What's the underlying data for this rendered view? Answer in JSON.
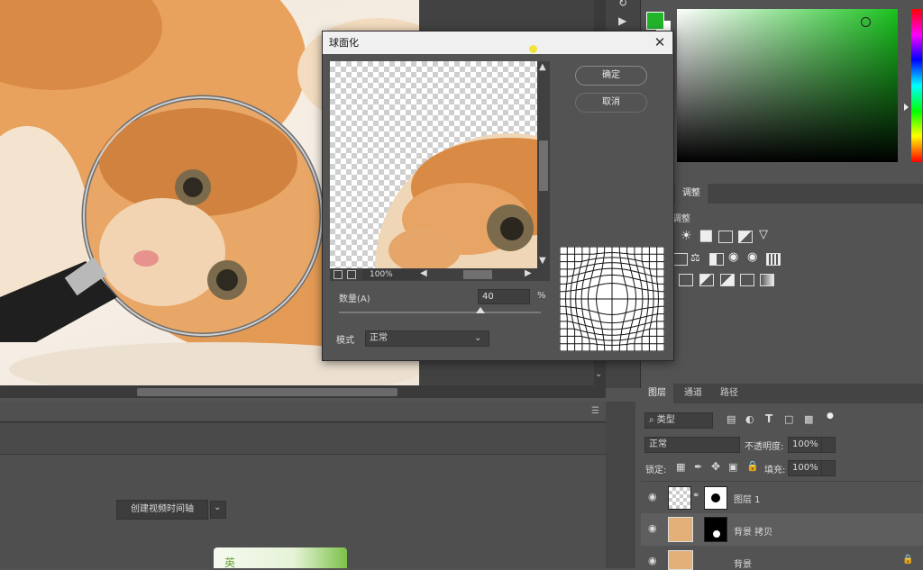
{
  "dialog": {
    "title": "球面化",
    "ok_label": "确定",
    "cancel_label": "取消",
    "zoom_value": "100%",
    "amount_label": "数量(A)",
    "amount_value": "40",
    "amount_unit": "%",
    "amount_level": 0.7,
    "mode_label": "模式",
    "mode_value": "正常"
  },
  "timeline": {
    "create_button_label": "创建视频时间轴"
  },
  "adjustments": {
    "tab_label": "调整",
    "heading": "调整"
  },
  "layers": {
    "tabs": [
      "图层",
      "通道",
      "路径"
    ],
    "filter_value": "类型",
    "blend_mode": "正常",
    "opacity_label": "不透明度:",
    "opacity_value": "100%",
    "lock_label": "锁定:",
    "fill_label": "填充:",
    "fill_value": "100%",
    "items": [
      {
        "name": "图层 1"
      },
      {
        "name": "背景 拷贝"
      },
      {
        "name": "背景"
      }
    ]
  },
  "colors": {
    "foreground": "#22b52c",
    "background": "#ffffff"
  },
  "thumbnail_card": {
    "text": "英"
  }
}
